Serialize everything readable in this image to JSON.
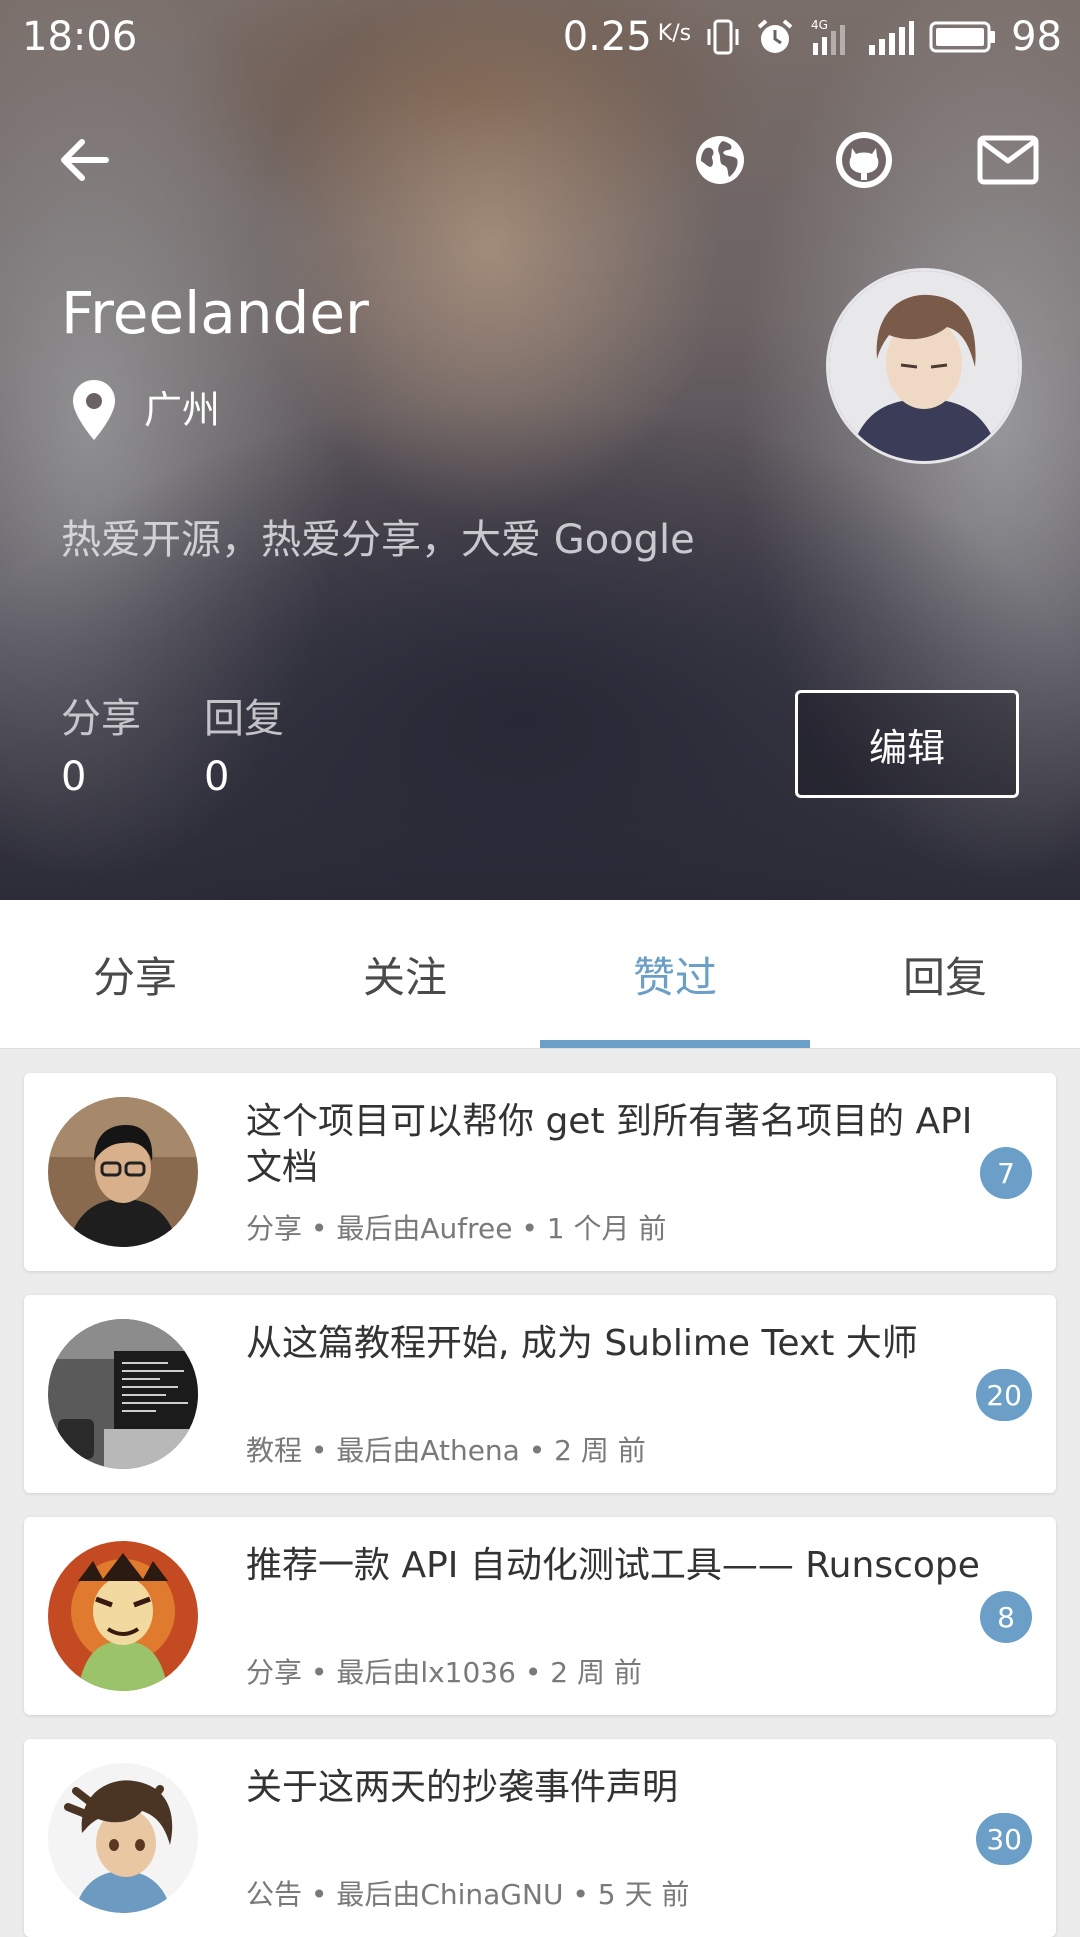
{
  "status_bar": {
    "time": "18:06",
    "net_speed": "0.25",
    "net_speed_unit": "K/s",
    "network_type": "4G",
    "battery": "98"
  },
  "toolbar": {
    "back_icon": "arrow-left-icon",
    "icons": [
      "globe-icon",
      "github-icon",
      "mail-icon"
    ]
  },
  "profile": {
    "name": "Freelander",
    "location": "广州",
    "bio": "热爱开源，热爱分享，大爱 Google",
    "stats": [
      {
        "label": "分享",
        "value": "0"
      },
      {
        "label": "回复",
        "value": "0"
      }
    ],
    "edit_label": "编辑"
  },
  "tabs": [
    {
      "label": "分享",
      "active": false
    },
    {
      "label": "关注",
      "active": false
    },
    {
      "label": "赞过",
      "active": true
    },
    {
      "label": "回复",
      "active": false
    }
  ],
  "posts": [
    {
      "title": "这个项目可以帮你 get 到所有著名项目的 API 文档",
      "meta": "分享 • 最后由Aufree • 1 个月 前",
      "count": "7"
    },
    {
      "title": "从这篇教程开始, 成为 Sublime Text 大师",
      "meta": "教程 • 最后由Athena • 2 周 前",
      "count": "20"
    },
    {
      "title": "推荐一款 API 自动化测试工具—— Runscope",
      "meta": "分享 • 最后由lx1036 • 2 周 前",
      "count": "8"
    },
    {
      "title": "关于这两天的抄袭事件声明",
      "meta": "公告 • 最后由ChinaGNU • 5 天 前",
      "count": "30"
    }
  ],
  "colors": {
    "accent": "#6b9fc8",
    "page_background": "#ececec",
    "text_dark": "#333333",
    "text_meta": "#7a7a7a"
  }
}
